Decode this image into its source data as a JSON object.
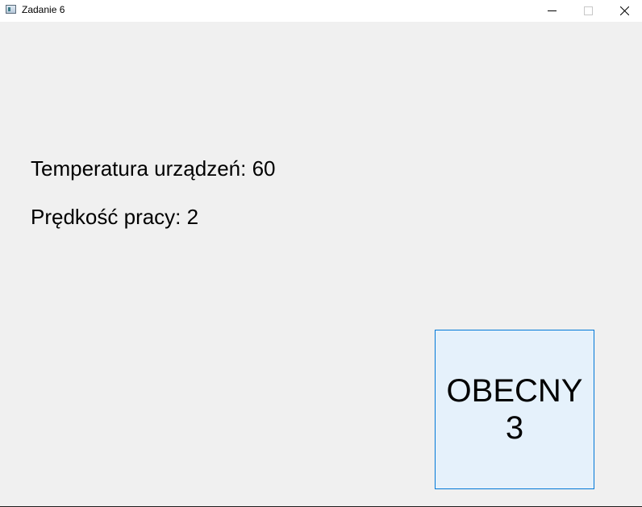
{
  "window": {
    "title": "Zadanie 6"
  },
  "titlebar": {
    "icons": {
      "app": "app-window-icon",
      "minimize": "minimize-icon",
      "maximize": "maximize-icon",
      "close": "close-icon"
    }
  },
  "main": {
    "temperature_label": "Temperatura urządzeń: 60",
    "speed_label": "Prędkość pracy: 2",
    "status_button": {
      "line1": "OBECNY",
      "line2": "3",
      "border_color": "#0078d7",
      "background_color": "#e5f1fb"
    }
  }
}
